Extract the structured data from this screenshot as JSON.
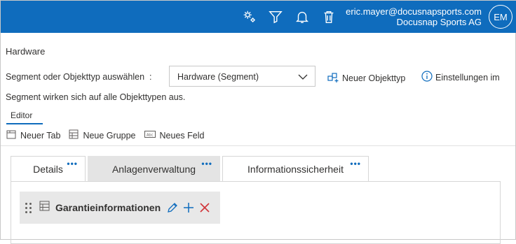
{
  "header": {
    "user_email": "eric.mayer@docusnapsports.com",
    "company": "Docusnap Sports AG",
    "avatar_initials": "EM",
    "icons": [
      "settings-gears-icon",
      "filter-icon",
      "bell-icon",
      "trash-icon"
    ],
    "bg_color": "#0f6cbd"
  },
  "page": {
    "title": "Hardware",
    "segment_label": "Segment oder Objekttyp auswählen  :",
    "segment_value": "Hardware (Segment)",
    "new_object_type": "Neuer Objekttyp",
    "settings_text": "Einstellungen im",
    "segment_note": "Segment wirken sich auf alle Objekttypen aus.",
    "editor_tab": "Editor"
  },
  "toolbar": {
    "new_tab": "Neuer Tab",
    "new_group": "Neue Gruppe",
    "new_field": "Neues Feld"
  },
  "tabs": [
    {
      "label": "Details",
      "menu": "•••"
    },
    {
      "label": "Anlagenverwaltung",
      "menu": "•••"
    },
    {
      "label": "Informationssicherheit",
      "menu": "•••"
    }
  ],
  "group": {
    "title": "Garantieinformationen"
  }
}
